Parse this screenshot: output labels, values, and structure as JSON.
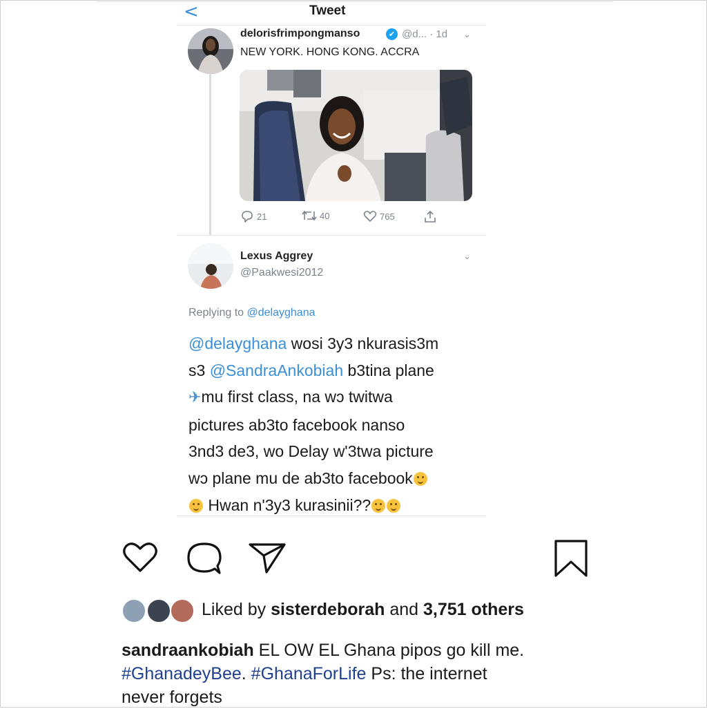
{
  "tweet_screen": {
    "back_label": "<",
    "title": "Tweet",
    "original_tweet": {
      "username": "delorisfrimpongmanso",
      "handle": "@d...",
      "time": "· 1d",
      "text": "NEW YORK. HONG KONG. ACCRA",
      "actions": {
        "replies": "21",
        "retweets": "40",
        "likes": "765"
      }
    },
    "reply_tweet": {
      "name": "Lexus Aggrey",
      "handle": "@Paakwesi2012",
      "replying_prefix": "Replying to",
      "replying_to": "@delayghana",
      "lines": [
        {
          "mention": "@delayghana",
          "text": "  wosi 3y3 nkurasis3m"
        },
        {
          "pre": "s3 ",
          "mention": "@SandraAnkobiah",
          "text": " b3tina plane"
        },
        {
          "text": "mu first class, na wɔ twitwa"
        },
        {
          "text": "pictures ab3to facebook nanso"
        },
        {
          "text": "3nd3 de3, wo Delay w'3twa picture"
        },
        {
          "text": "wɔ plane mu de ab3to facebook"
        },
        {
          "text": " Hwan n'3y3 kurasinii??"
        }
      ]
    }
  },
  "instagram": {
    "likes": {
      "prefix": "Liked by ",
      "user": "sisterdeborah",
      "middle": " and ",
      "count": "3,751 others"
    },
    "caption": {
      "username": "sandraankobiah",
      "text": " EL OW EL Ghana pipos go kill me.",
      "hashtag1": "#GhanadeyBee",
      "sep": ". ",
      "hashtag2": "#GhanaForLife",
      "rest_line2": "  Ps: the internet",
      "rest_line3": "never forgets"
    }
  },
  "colors": {
    "link": "#3a8fd8",
    "hashtag": "#1f3f8f",
    "verified": "#1da1f2"
  }
}
